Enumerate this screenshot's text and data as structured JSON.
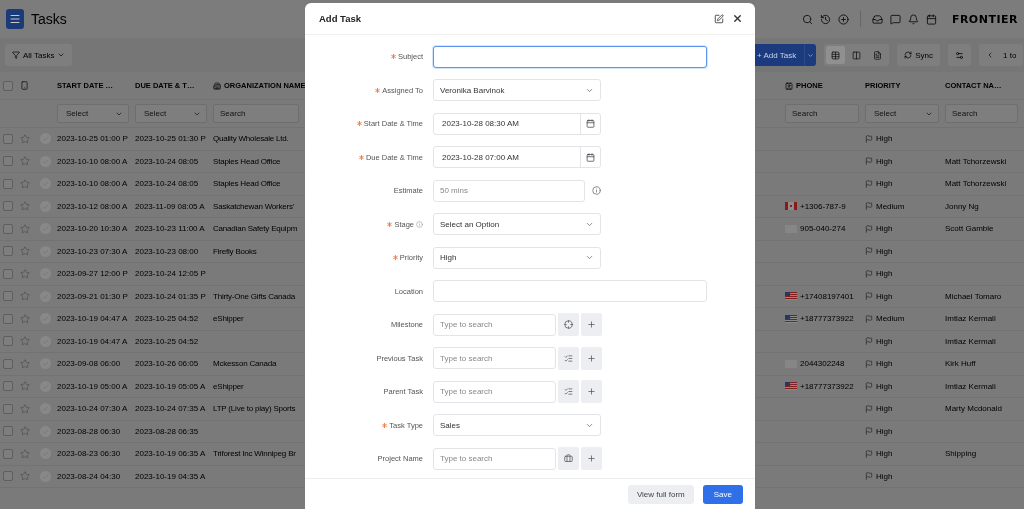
{
  "app": {
    "title": "Tasks",
    "logo": "FRONTIER"
  },
  "toolbar": {
    "filter": "All Tasks",
    "add_button": "+ Add Task",
    "sync": "Sync",
    "pager": "1 to",
    "views": [
      {
        "selected": true
      },
      {
        "selected": false
      },
      {
        "selected": false
      }
    ]
  },
  "table": {
    "header_checked": false,
    "left_columns": [
      "START DATE …",
      "DUE DATE & T…",
      "ORGANIZATION NAME"
    ],
    "right_columns": [
      "PHONE",
      "PRIORITY",
      "CONTACT NA…"
    ],
    "left_filters": [
      {
        "kind": "select",
        "text": "Select"
      },
      {
        "kind": "select",
        "text": "Select"
      },
      {
        "kind": "search",
        "placeholder": "Search"
      }
    ],
    "right_filters": [
      {
        "kind": "search",
        "placeholder": "Search"
      },
      {
        "kind": "select",
        "text": "Select"
      },
      {
        "kind": "search",
        "placeholder": "Search"
      }
    ],
    "rows": [
      {
        "checked": false,
        "starred": false,
        "start": "2023-10-25 01:00 P",
        "due": "2023-10-25 01:30 P",
        "organization": "Quality Wholesale Ltd.",
        "priority": "High"
      },
      {
        "checked": false,
        "starred": false,
        "start": "2023-10-10 08:00 A",
        "due": "2023-10-24 08:05",
        "organization": "Staples Head Office",
        "priority": "High",
        "contact": "Matt Tchorzewski"
      },
      {
        "checked": false,
        "starred": false,
        "start": "2023-10-10 08:00 A",
        "due": "2023-10-24 08:05",
        "organization": "Staples Head Office",
        "priority": "High",
        "contact": "Matt Tchorzewski"
      },
      {
        "checked": false,
        "starred": false,
        "start": "2023-10-12 08:00 A",
        "due": "2023-11-09 08:05 A",
        "organization": "Saskatchewan Workers'",
        "phone": "+1306-787-9",
        "priority": "Medium",
        "contact": "Jonny Ng"
      },
      {
        "checked": false,
        "starred": false,
        "start": "2023-10-20 10:30 A",
        "due": "2023-10-23 11:00 A",
        "organization": "Canadian Safety Equipm",
        "phone": "905-040-274",
        "priority": "High",
        "contact": "Scott Gamble"
      },
      {
        "checked": false,
        "starred": false,
        "start": "2023-10-23 07:30 A",
        "due": "2023-10-23 08:00",
        "organization": "Firefly Books",
        "priority": "High"
      },
      {
        "checked": false,
        "starred": false,
        "start": "2023-09-27 12:00 P",
        "due": "2023-10-24 12:05 P",
        "priority": "High"
      },
      {
        "checked": false,
        "starred": false,
        "start": "2023-09-21 01:30 P",
        "due": "2023-10-24 01:35 P",
        "organization": "Thirty-One Gifts Canada",
        "phone": "+17408197401",
        "priority": "High",
        "contact": "Michael Tomaro"
      },
      {
        "checked": false,
        "starred": false,
        "start": "2023-10-19 04:47 A",
        "due": "2023-10-25 04:52",
        "organization": "eShipper",
        "phone": "+18777373922",
        "priority": "Medium",
        "contact": "Imtiaz Kermali"
      },
      {
        "checked": false,
        "starred": false,
        "start": "2023-10-19 04:47 A",
        "due": "2023-10-25 04:52",
        "priority": "High",
        "contact": "Imtiaz Kermali"
      },
      {
        "checked": false,
        "starred": false,
        "start": "2023-09-08 06:00",
        "due": "2023-10-26 06:05",
        "organization": "Mckesson Canada",
        "phone": "2044302248",
        "priority": "High",
        "contact": "Kirk Huff"
      },
      {
        "checked": false,
        "starred": false,
        "start": "2023-10-19 05:00 A",
        "due": "2023-10-19 05:05 A",
        "organization": "eShipper",
        "phone": "+18777373922",
        "priority": "High",
        "contact": "Imtiaz Kermali"
      },
      {
        "checked": false,
        "starred": false,
        "start": "2023-10-24 07:30 A",
        "due": "2023-10-24 07:35 A",
        "organization": "LTP (Live to play) Sports",
        "priority": "High",
        "contact": "Marty Mcdonald"
      },
      {
        "checked": false,
        "starred": false,
        "start": "2023-08-28 06:30",
        "due": "2023-08-28 06:35",
        "priority": "High"
      },
      {
        "checked": false,
        "starred": false,
        "start": "2023-08-23 06:30",
        "due": "2023-10-19 06:35 A",
        "organization": "Triforest Inc Winnipeg Br",
        "priority": "High",
        "contact": "Shipping"
      },
      {
        "checked": false,
        "starred": false,
        "start": "2023-08-24 04:30",
        "due": "2023-10-19 04:35 A",
        "priority": "High"
      }
    ]
  },
  "dialog": {
    "title": "Add Task",
    "fields": [
      {
        "label": "Subject",
        "required": true,
        "kind": "text",
        "focused": true
      },
      {
        "label": "Assigned To",
        "required": true,
        "kind": "select",
        "value": "Veronika Barvinok"
      },
      {
        "label": "Start Date & Time",
        "required": true,
        "kind": "date",
        "value": "2023-10-28 08:30 AM"
      },
      {
        "label": "Due Date & Time",
        "required": true,
        "kind": "date",
        "value": "2023-10-28 07:00 AM"
      },
      {
        "label": "Estimate",
        "required": false,
        "kind": "estimate",
        "placeholder": "50 mins"
      },
      {
        "label": "Stage",
        "required": true,
        "label_info": true,
        "kind": "select",
        "value": "Select an Option"
      },
      {
        "label": "Priority",
        "required": true,
        "kind": "select",
        "value": "High"
      },
      {
        "label": "Location",
        "required": false,
        "kind": "text",
        "focused": false
      },
      {
        "label": "Milestone",
        "required": false,
        "kind": "lookup",
        "placeholder": "Type to search"
      },
      {
        "label": "Previous Task",
        "required": false,
        "kind": "lookup",
        "placeholder": "Type to search"
      },
      {
        "label": "Parent Task",
        "required": false,
        "kind": "lookup",
        "placeholder": "Type to search"
      },
      {
        "label": "Task Type",
        "required": true,
        "kind": "select",
        "value": "Sales"
      },
      {
        "label": "Project Name",
        "required": false,
        "kind": "lookup",
        "placeholder": "Type to search"
      }
    ],
    "buttons": [
      {
        "label": "View full form",
        "kind": "secondary"
      },
      {
        "label": "Save",
        "kind": "primary"
      }
    ]
  }
}
